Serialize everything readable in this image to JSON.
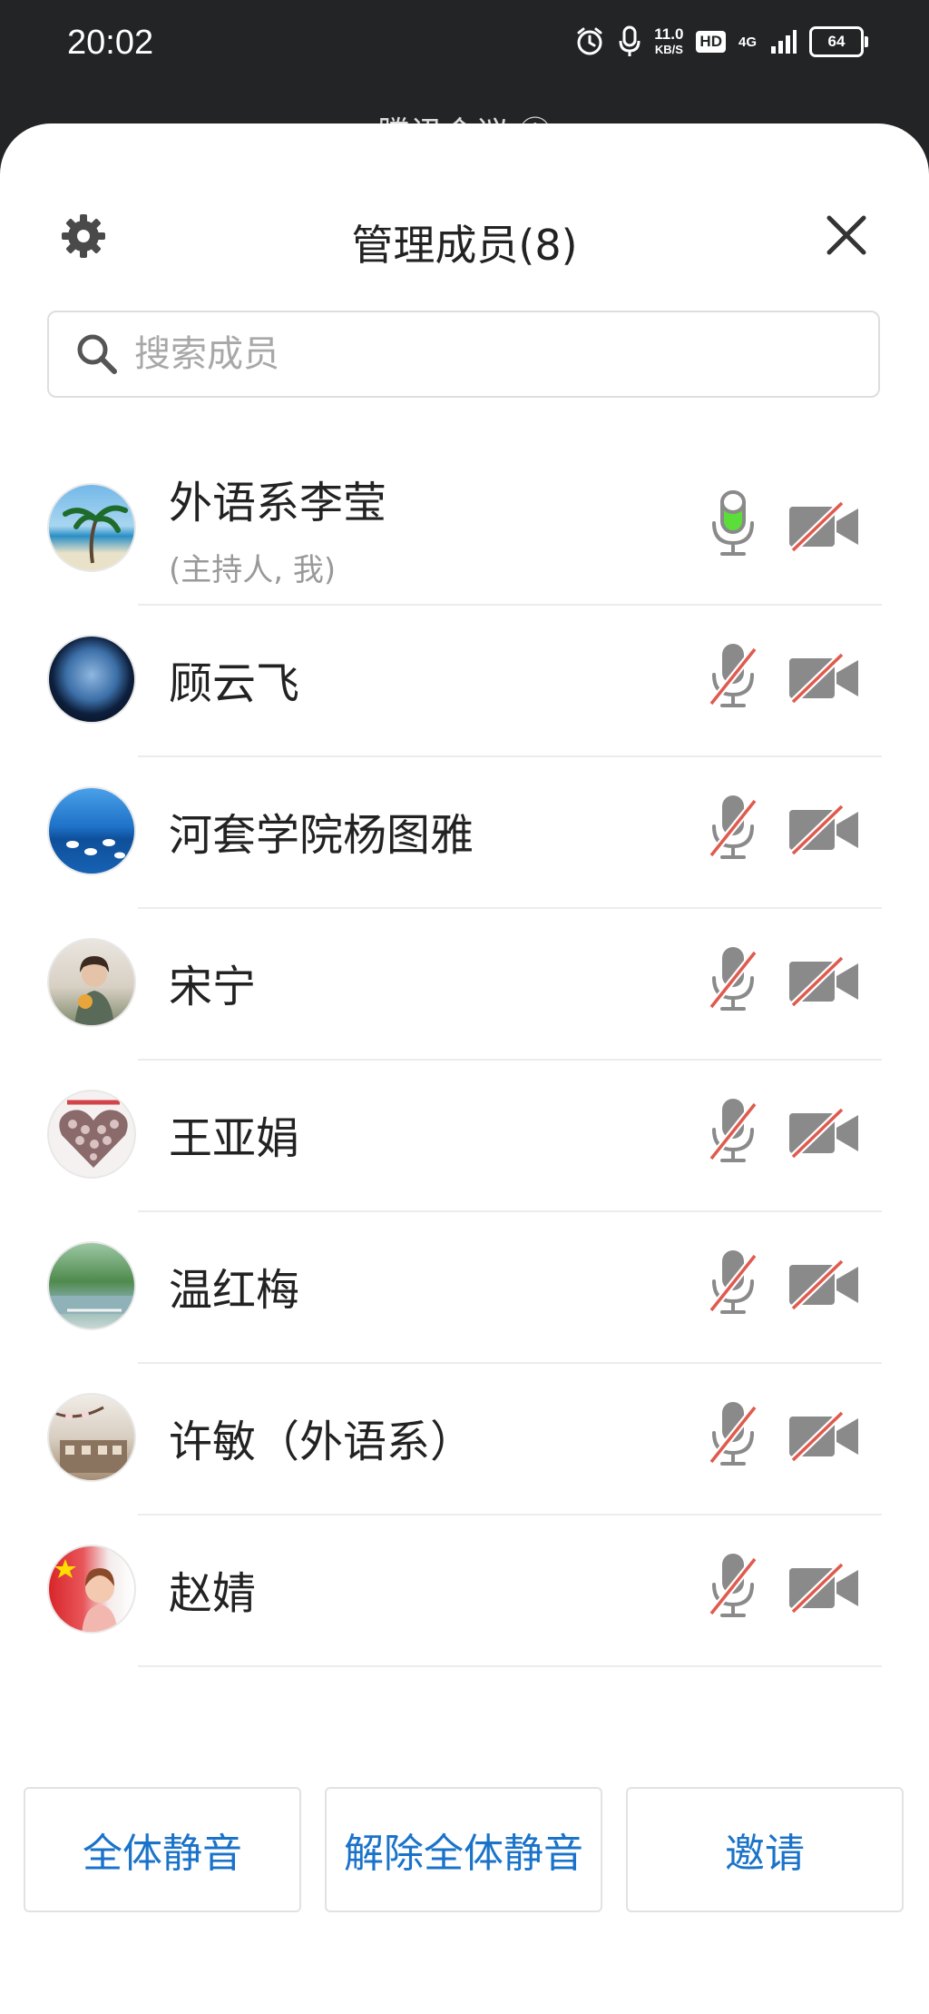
{
  "status_bar": {
    "time": "20:02",
    "net_speed_value": "11.0",
    "net_speed_unit": "KB/S",
    "hd_label": "HD",
    "network": "4G",
    "battery": "64"
  },
  "background_title": "腾讯会议 ⓘ",
  "header": {
    "title": "管理成员(8)"
  },
  "search": {
    "placeholder": "搜索成员"
  },
  "members": [
    {
      "name": "外语系李莹",
      "role": "(主持人, 我)",
      "mic_on": true,
      "camera_on": false
    },
    {
      "name": "顾云飞",
      "role": "",
      "mic_on": false,
      "camera_on": false
    },
    {
      "name": "河套学院杨图雅",
      "role": "",
      "mic_on": false,
      "camera_on": false
    },
    {
      "name": "宋宁",
      "role": "",
      "mic_on": false,
      "camera_on": false
    },
    {
      "name": "王亚娟",
      "role": "",
      "mic_on": false,
      "camera_on": false
    },
    {
      "name": "温红梅",
      "role": "",
      "mic_on": false,
      "camera_on": false
    },
    {
      "name": "许敏（外语系）",
      "role": "",
      "mic_on": false,
      "camera_on": false
    },
    {
      "name": "赵婧",
      "role": "",
      "mic_on": false,
      "camera_on": false
    }
  ],
  "footer": {
    "mute_all": "全体静音",
    "unmute_all": "解除全体静音",
    "invite": "邀请"
  },
  "colors": {
    "accent": "#1A73C9",
    "mic_active": "#5BDD3A",
    "muted_slash": "#E05A4E",
    "icon_gray": "#8A8A8A"
  }
}
